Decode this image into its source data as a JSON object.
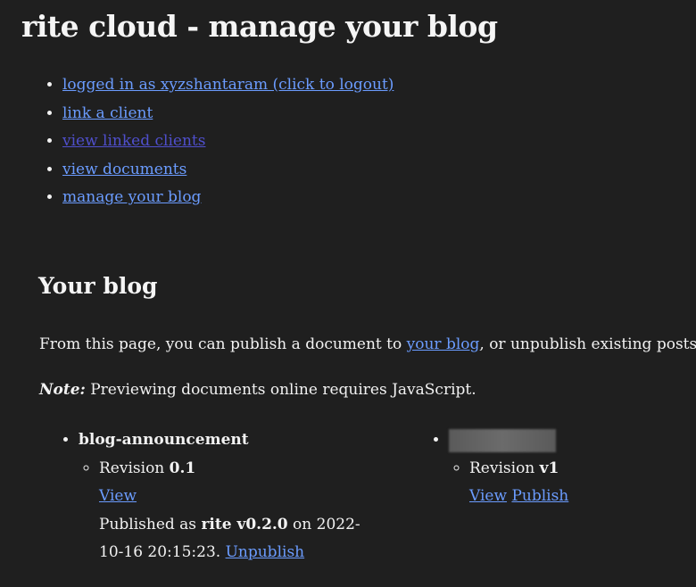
{
  "header": {
    "title": "rite cloud - manage your blog"
  },
  "nav": {
    "items": [
      {
        "label": "logged in as xyzshantaram (click to logout)"
      },
      {
        "label": "link a client"
      },
      {
        "label": "view linked clients"
      },
      {
        "label": "view documents"
      },
      {
        "label": "manage your blog"
      }
    ]
  },
  "main": {
    "heading": "Your blog",
    "intro_prefix": "From this page, you can publish a document to ",
    "intro_link": "your blog",
    "intro_suffix": ", or unpublish existing posts.",
    "note_label": "Note:",
    "note_text": " Previewing documents online requires JavaScript."
  },
  "documents": [
    {
      "title": "blog-announcement",
      "revision_prefix": "Revision ",
      "revision": "0.1",
      "view_label": "View",
      "published_prefix": "Published as ",
      "published_version": "rite v0.2.0",
      "published_suffix": " on 2022-10-16 20:15:23. ",
      "unpublish_label": "Unpublish"
    },
    {
      "title": "",
      "revision_prefix": "Revision ",
      "revision": "v1",
      "view_label": "View",
      "publish_label": "Publish"
    }
  ]
}
